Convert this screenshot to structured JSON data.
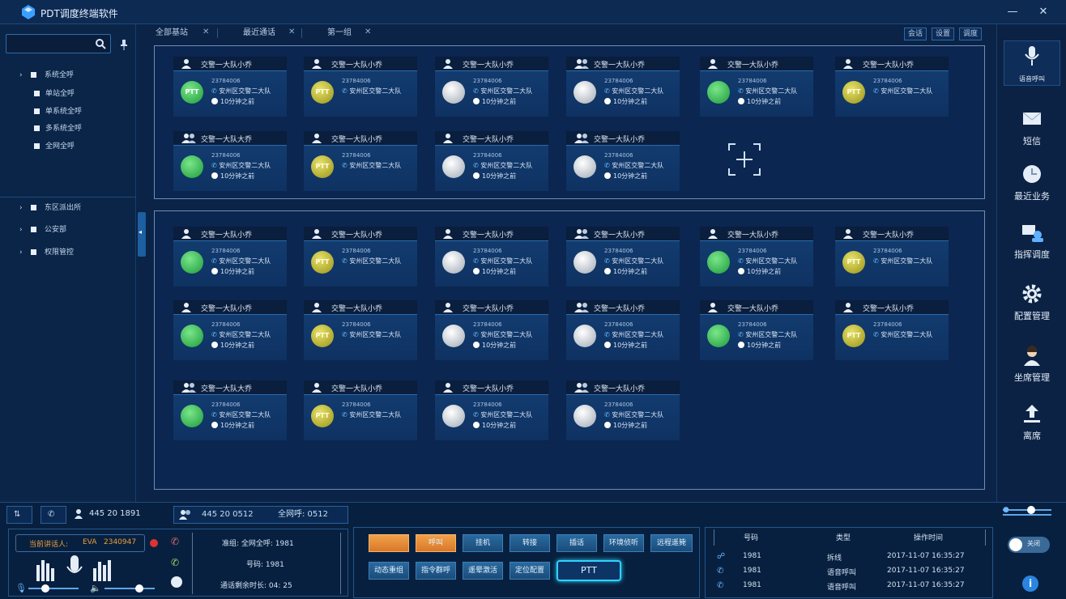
{
  "app": {
    "title": "PDT调度终端软件"
  },
  "sidebar": {
    "search_placeholder": "",
    "tree": [
      {
        "label": "系统全呼",
        "type": "group"
      },
      {
        "label": "单站全呼",
        "type": "sub"
      },
      {
        "label": "单系统全呼",
        "type": "sub"
      },
      {
        "label": "多系统全呼",
        "type": "sub"
      },
      {
        "label": "全网全呼",
        "type": "sub"
      }
    ],
    "tree2": [
      {
        "label": "东区派出所"
      },
      {
        "label": "公安部"
      },
      {
        "label": "权限管控"
      }
    ]
  },
  "tabs": [
    {
      "label": "全部基站"
    },
    {
      "label": "最近通话"
    },
    {
      "label": "第一组"
    }
  ],
  "toolbar_right": [
    "会话",
    "设置",
    "调度"
  ],
  "cards_top": [
    {
      "name": "交警一大队小乔",
      "status": "g",
      "ball": "PTT",
      "num": "23784006",
      "grp": "安州区交警二大队",
      "time": "10分钟之前",
      "icon": "user"
    },
    {
      "name": "交警一大队小乔",
      "status": "y",
      "ball": "PTT",
      "num": "23784006",
      "grp": "安州区交警二大队",
      "time": "",
      "icon": "user"
    },
    {
      "name": "交警一大队小乔",
      "status": "w",
      "ball": "",
      "num": "23784006",
      "grp": "安州区交警二大队",
      "time": "10分钟之前",
      "icon": "user"
    },
    {
      "name": "交警一大队小乔",
      "status": "w",
      "ball": "",
      "num": "23784006",
      "grp": "安州区交警二大队",
      "time": "10分钟之前",
      "icon": "group"
    },
    {
      "name": "交警一大队小乔",
      "status": "g",
      "ball": "",
      "num": "23784006",
      "grp": "安州区交警二大队",
      "time": "10分钟之前",
      "icon": "user"
    },
    {
      "name": "交警一大队小乔",
      "status": "y",
      "ball": "PTT",
      "num": "23784006",
      "grp": "安州区交警二大队",
      "time": "",
      "icon": "user"
    },
    {
      "name": "交警一大队大乔",
      "status": "g",
      "ball": "",
      "num": "23784006",
      "grp": "安州区交警二大队",
      "time": "10分钟之前",
      "icon": "group"
    },
    {
      "name": "交警一大队小乔",
      "status": "y",
      "ball": "PTT",
      "num": "23784006",
      "grp": "安州区交警二大队",
      "time": "",
      "icon": "user"
    },
    {
      "name": "交警一大队小乔",
      "status": "w",
      "ball": "",
      "num": "23784006",
      "grp": "安州区交警二大队",
      "time": "10分钟之前",
      "icon": "user"
    },
    {
      "name": "交警一大队小乔",
      "status": "w",
      "ball": "",
      "num": "23784006",
      "grp": "安州区交警二大队",
      "time": "10分钟之前",
      "icon": "group"
    }
  ],
  "cards_bottom": [
    {
      "name": "交警一大队小乔",
      "status": "g",
      "ball": "",
      "num": "23784006",
      "grp": "安州区交警二大队",
      "time": "10分钟之前",
      "icon": "user"
    },
    {
      "name": "交警一大队小乔",
      "status": "y",
      "ball": "PTT",
      "num": "23784006",
      "grp": "安州区交警二大队",
      "time": "",
      "icon": "user"
    },
    {
      "name": "交警一大队小乔",
      "status": "w",
      "ball": "",
      "num": "23784006",
      "grp": "安州区交警二大队",
      "time": "10分钟之前",
      "icon": "user"
    },
    {
      "name": "交警一大队小乔",
      "status": "w",
      "ball": "",
      "num": "23784006",
      "grp": "安州区交警二大队",
      "time": "10分钟之前",
      "icon": "group"
    },
    {
      "name": "交警一大队小乔",
      "status": "g",
      "ball": "",
      "num": "23784006",
      "grp": "安州区交警二大队",
      "time": "10分钟之前",
      "icon": "user"
    },
    {
      "name": "交警一大队小乔",
      "status": "y",
      "ball": "PTT",
      "num": "23784006",
      "grp": "安州区交警二大队",
      "time": "",
      "icon": "user"
    },
    {
      "name": "交警一大队小乔",
      "status": "g",
      "ball": "",
      "num": "23784006",
      "grp": "安州区交警二大队",
      "time": "10分钟之前",
      "icon": "user"
    },
    {
      "name": "交警一大队小乔",
      "status": "y",
      "ball": "PTT",
      "num": "23784006",
      "grp": "安州区交警二大队",
      "time": "",
      "icon": "user"
    },
    {
      "name": "交警一大队小乔",
      "status": "w",
      "ball": "",
      "num": "23784006",
      "grp": "安州区交警二大队",
      "time": "10分钟之前",
      "icon": "user"
    },
    {
      "name": "交警一大队小乔",
      "status": "w",
      "ball": "",
      "num": "23784006",
      "grp": "安州区交警二大队",
      "time": "10分钟之前",
      "icon": "group"
    },
    {
      "name": "交警一大队小乔",
      "status": "g",
      "ball": "",
      "num": "23784006",
      "grp": "安州区交警二大队",
      "time": "10分钟之前",
      "icon": "user"
    },
    {
      "name": "交警一大队小乔",
      "status": "y",
      "ball": "PTT",
      "num": "23784006",
      "grp": "安州区交警二大队",
      "time": "",
      "icon": "user"
    },
    {
      "name": "交警一大队大乔",
      "status": "g",
      "ball": "",
      "num": "23784006",
      "grp": "安州区交警二大队",
      "time": "10分钟之前",
      "icon": "group"
    },
    {
      "name": "交警一大队小乔",
      "status": "y",
      "ball": "PTT",
      "num": "23784006",
      "grp": "安州区交警二大队",
      "time": "",
      "icon": "user"
    },
    {
      "name": "交警一大队小乔",
      "status": "w",
      "ball": "",
      "num": "23784006",
      "grp": "安州区交警二大队",
      "time": "10分钟之前",
      "icon": "user"
    },
    {
      "name": "交警一大队小乔",
      "status": "w",
      "ball": "",
      "num": "23784006",
      "grp": "安州区交警二大队",
      "time": "10分钟之前",
      "icon": "group"
    }
  ],
  "rightnav": [
    {
      "label": "语音呼叫",
      "icon": "mic-icon"
    },
    {
      "label": "短信",
      "icon": "message-icon"
    },
    {
      "label": "最近业务",
      "icon": "clock-icon"
    },
    {
      "label": "指挥调度",
      "icon": "dispatch-icon"
    },
    {
      "label": "配置管理",
      "icon": "gear-icon"
    },
    {
      "label": "坐席管理",
      "icon": "agent-icon"
    },
    {
      "label": "离席",
      "icon": "upload-icon"
    }
  ],
  "statusbar": {
    "user_id": "445 20 1891",
    "group_id": "445 20 0512",
    "group_call": "全网呼: 0512"
  },
  "caller": {
    "label": "当前讲话人:",
    "name": "EVA",
    "num": "2340947"
  },
  "callinfo": {
    "group": "准组: 全网全呼: 1981",
    "num": "号码: 1981",
    "time": "通话剩余时长: 04: 25"
  },
  "ops_row1": [
    "",
    "呼叫",
    "挂机",
    "转接",
    "插话",
    "环境侦听",
    "远程遥毙"
  ],
  "ops_row2": [
    "动态重组",
    "指令群呼",
    "遥晕激活",
    "定位配置"
  ],
  "ptt_label": "PTT",
  "recent": {
    "headers": [
      "号码",
      "类型",
      "操作时间"
    ],
    "rows": [
      {
        "num": "1981",
        "type": "拆线",
        "time": "2017-11-07 16:35:27"
      },
      {
        "num": "1981",
        "type": "语音呼叫",
        "time": "2017-11-07 16:35:27"
      },
      {
        "num": "1981",
        "type": "语音呼叫",
        "time": "2017-11-07 16:35:27"
      }
    ]
  },
  "toggle_label": "关闭"
}
